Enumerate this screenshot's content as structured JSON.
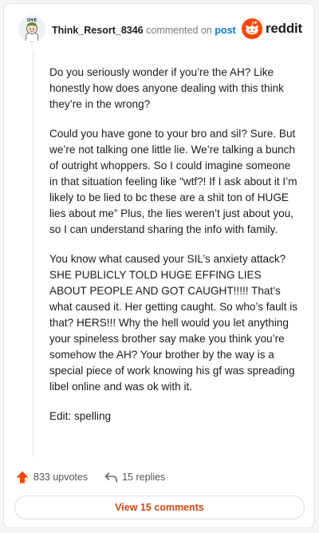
{
  "header": {
    "username": "Think_Resort_8346",
    "commented_text": "commented on",
    "post_link": "post",
    "brand": "reddit",
    "avatar_caption": "OYE"
  },
  "comment": {
    "paragraphs": [
      "Do you seriously wonder if you’re the AH? Like honestly how does anyone dealing with this think they’re in the wrong?",
      "Could you have gone to your bro and sil? Sure. But we’re not talking one little lie. We’re talking a bunch of outright whoppers. So I could imagine someone in that situation feeling like “wtf?! If I ask about it I’m likely to be lied to bc these are a shit ton of HUGE lies about me” Plus, the lies weren’t just about you, so I can understand sharing the info with family.",
      "You know what caused your SIL’s anxiety attack? SHE PUBLICLY TOLD HUGE EFFING LIES ABOUT PEOPLE AND GOT CAUGHT!!!!! That’s what caused it. Her getting caught. So who’s fault is that? HERS!!! Why the hell would you let anything your spineless brother say make you think you’re somehow the AH? Your brother by the way is a special piece of work knowing his gf was spreading libel online and was ok with it.",
      "Edit: spelling"
    ]
  },
  "actions": {
    "upvotes_label": "833 upvotes",
    "replies_label": "15 replies"
  },
  "footer": {
    "view_comments_label": "View 15 comments"
  },
  "colors": {
    "brand_orange": "#ff4500",
    "link_blue": "#0079d3",
    "view_button_text": "#c64a12"
  },
  "icons": {
    "upvote": "upvote-arrow-icon",
    "reply": "reply-arrow-icon",
    "logo": "reddit-snoo-icon"
  }
}
